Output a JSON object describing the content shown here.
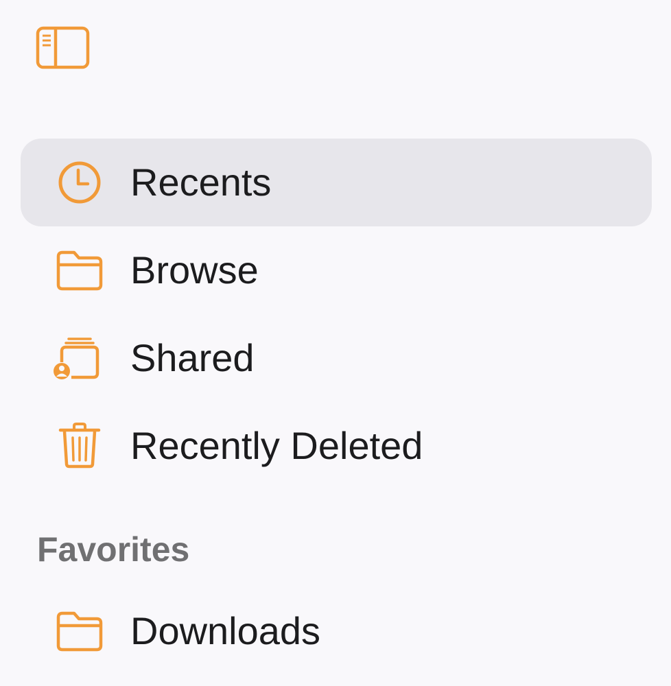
{
  "toolbar": {
    "sidebar_toggle_icon": "sidebar-left-icon"
  },
  "accent_color": "#f19a38",
  "nav": {
    "items": [
      {
        "label": "Recents",
        "icon": "clock-icon",
        "selected": true
      },
      {
        "label": "Browse",
        "icon": "folder-icon",
        "selected": false
      },
      {
        "label": "Shared",
        "icon": "shared-folder-icon",
        "selected": false
      },
      {
        "label": "Recently Deleted",
        "icon": "trash-icon",
        "selected": false
      }
    ]
  },
  "favorites": {
    "header": "Favorites",
    "items": [
      {
        "label": "Downloads",
        "icon": "folder-icon",
        "selected": false
      }
    ]
  }
}
